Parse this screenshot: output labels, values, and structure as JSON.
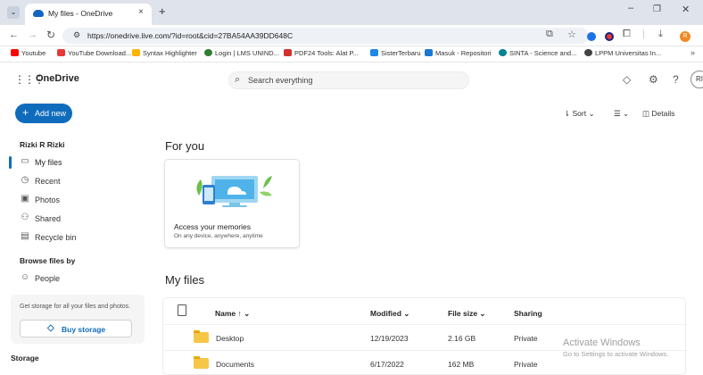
{
  "browser": {
    "tab_title": "My files - OneDrive",
    "tab_close": "×",
    "new_tab": "+",
    "url": "https://onedrive.live.com/?id=root&cid=27BA54AA39DD648C",
    "profile_initial": "R",
    "bookmarks": [
      {
        "label": "Youtube",
        "color": "#ff0000"
      },
      {
        "label": "YouTube Download...",
        "color": "#e53935"
      },
      {
        "label": "Syntax Highlighter",
        "color": "#ffb300"
      },
      {
        "label": "Login | LMS UNIND...",
        "color": "#2e7d32"
      },
      {
        "label": "PDF24 Tools: Alat P...",
        "color": "#d32f2f"
      },
      {
        "label": "SisterTerbaru",
        "color": "#1e88e5"
      },
      {
        "label": "Masuk - Repositori",
        "color": "#1976d2"
      },
      {
        "label": "SINTA - Science and...",
        "color": "#00838f"
      },
      {
        "label": "LPPM Universitas In...",
        "color": "#424242"
      }
    ],
    "bookmarks_more": "»"
  },
  "app": {
    "name": "OneDrive",
    "search_placeholder": "Search everything",
    "avatar_initials": "RI"
  },
  "sidebar": {
    "add_new": "Add new",
    "user_name": "Rizki R Rizki",
    "items": [
      {
        "label": "My files",
        "icon": "folder-icon"
      },
      {
        "label": "Recent",
        "icon": "clock-icon"
      },
      {
        "label": "Photos",
        "icon": "image-icon"
      },
      {
        "label": "Shared",
        "icon": "people-icon"
      },
      {
        "label": "Recycle bin",
        "icon": "trash-icon"
      }
    ],
    "browse_heading": "Browse files by",
    "people": "People",
    "storage_promo": "Get storage for all your files and photos.",
    "buy_storage": "Buy storage",
    "storage_heading": "Storage"
  },
  "toolbar": {
    "sort": "Sort",
    "details": "Details"
  },
  "main": {
    "for_you_title": "For you",
    "card_title": "Access your memories",
    "card_subtitle": "On any device, anywhere, anytime",
    "my_files_title": "My files",
    "columns": [
      "Name ↑ ⌄",
      "Modified ⌄",
      "File size ⌄",
      "Sharing"
    ],
    "rows": [
      {
        "name": "Desktop",
        "modified": "12/19/2023",
        "size": "2.16 GB",
        "sharing": "Private"
      },
      {
        "name": "Documents",
        "modified": "6/17/2022",
        "size": "162 MB",
        "sharing": "Private"
      }
    ]
  },
  "watermark": {
    "line1": "Activate Windows",
    "line2": "Go to Settings to activate Windows."
  },
  "colors": {
    "accent": "#0f6cbd",
    "folder": "#f6c646"
  }
}
